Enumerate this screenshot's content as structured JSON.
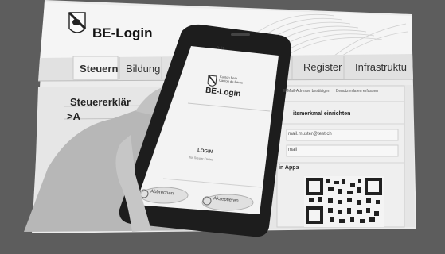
{
  "app": {
    "brand": "BE-Login"
  },
  "nav": {
    "tabs": [
      {
        "label": "Steuern"
      },
      {
        "label": "Bildung"
      },
      {
        "label": "Register"
      },
      {
        "label": "Infrastruktu"
      }
    ]
  },
  "content": {
    "section_title": "Steuererklär",
    "subsection": ">A",
    "stepper": {
      "items": [
        "E-Mail-Adresse bestätigen",
        "Benutzerdaten erfassen"
      ]
    },
    "security_heading": "itsmerkmal einrichten",
    "email_value": "mail.muster@test.ch",
    "email_label": "mail",
    "apps_label": "in Apps"
  },
  "phone": {
    "status_time": "9:41",
    "header_small_1": "Kanton Bern",
    "header_small_2": "Canton de Berne",
    "app_title": "BE-Login",
    "login_label": "LOGIN",
    "login_sub": "für Steuer Online",
    "cancel_label": "Abbrechen",
    "accept_label": "Akzeptieren"
  },
  "colors": {
    "frame": "#5d5d5d",
    "page": "#e9e9e9",
    "phone_body": "#1d1d1d",
    "phone_screen": "#f2f2f2"
  }
}
